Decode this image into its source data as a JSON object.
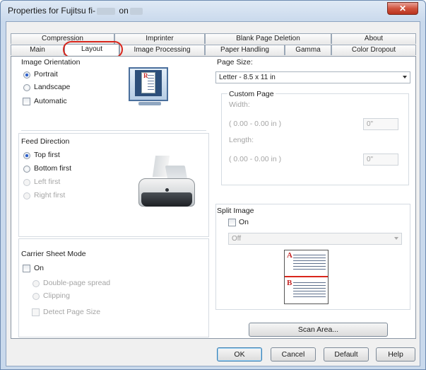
{
  "window": {
    "title_prefix": "Properties for Fujitsu fi-",
    "title_mid": "on",
    "close_label": "✕"
  },
  "tabs": {
    "row1": [
      "Compression",
      "Imprinter",
      "Blank Page Deletion",
      "About"
    ],
    "row2": [
      "Main",
      "Layout",
      "Image Processing",
      "Paper Handling",
      "Gamma",
      "Color Dropout"
    ],
    "active": "Layout",
    "highlight_color": "#d9261c"
  },
  "orientation": {
    "title": "Image Orientation",
    "portrait": "Portrait",
    "landscape": "Landscape",
    "automatic": "Automatic",
    "selected": "Portrait",
    "preview_letter": "R"
  },
  "feed": {
    "title": "Feed Direction",
    "options": [
      "Top first",
      "Bottom first",
      "Left first",
      "Right first"
    ],
    "selected": "Top first"
  },
  "carrier": {
    "title": "Carrier Sheet Mode",
    "on_label": "On",
    "double_page": "Double-page spread",
    "clipping": "Clipping",
    "detect": "Detect Page Size"
  },
  "page_size": {
    "title": "Page Size:",
    "value": "Letter - 8.5 x 11 in",
    "custom_title": "Custom Page",
    "width_label": "Width:",
    "width_range": "( 0.00 - 0.00 in )",
    "width_value": "0\"",
    "length_label": "Length:",
    "length_range": "( 0.00 - 0.00 in )",
    "length_value": "0\""
  },
  "split": {
    "title": "Split Image",
    "on_label": "On",
    "select_value": "Off",
    "part_a": "A",
    "part_b": "B"
  },
  "buttons": {
    "scan_area": "Scan Area...",
    "ok": "OK",
    "cancel": "Cancel",
    "default": "Default",
    "help": "Help"
  }
}
